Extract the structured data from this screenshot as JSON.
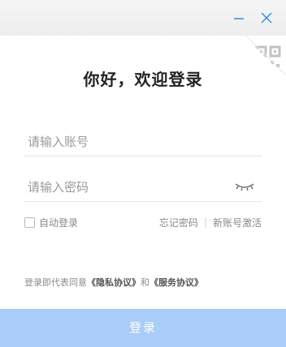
{
  "window": {
    "minimize_label": "minimize",
    "close_label": "close"
  },
  "header": {
    "title": "你好，欢迎登录"
  },
  "form": {
    "account_placeholder": "请输入账号",
    "account_value": "",
    "password_placeholder": "请输入密码",
    "password_value": "",
    "remember_label": "自动登录",
    "remember_checked": false
  },
  "links": {
    "forgot_password": "忘记密码",
    "separator": "|",
    "activate_account": "新账号激活"
  },
  "agreement": {
    "prefix": "登录即代表同意",
    "privacy": "《隐私协议》",
    "conjunction": "和",
    "service": "《服务协议》"
  },
  "actions": {
    "login_label": "登录"
  },
  "colors": {
    "titlebar": "#eeeeee",
    "window_icons": "#2f8ee6",
    "login_button": "#a9cdf6",
    "qr_corner": "#c9c9c9"
  },
  "icons": {
    "minimize": "minimize-icon",
    "close": "close-icon",
    "qr": "qr-code-icon",
    "password_toggle": "eye-closed-icon"
  }
}
